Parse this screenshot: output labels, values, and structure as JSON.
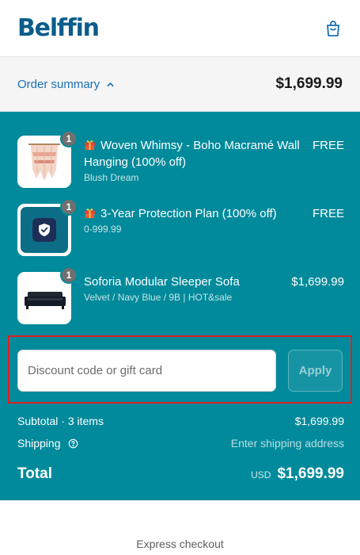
{
  "brand": {
    "logo_text": "Belffin"
  },
  "summary": {
    "toggle_label": "Order summary",
    "total": "$1,699.99"
  },
  "items": [
    {
      "title": "Woven Whimsy - Boho Macramé Wall Hanging (100% off)",
      "variant": "Blush Dream",
      "price": "FREE",
      "quantity": "1",
      "gift": true
    },
    {
      "title": "3-Year Protection Plan (100% off)",
      "variant": "0-999.99",
      "price": "FREE",
      "quantity": "1",
      "gift": true
    },
    {
      "title": "Soforia Modular Sleeper Sofa",
      "variant": "Velvet / Navy Blue / 9B | HOT&sale",
      "price": "$1,699.99",
      "quantity": "1",
      "gift": false
    }
  ],
  "discount": {
    "placeholder": "Discount code or gift card",
    "value": "",
    "apply_label": "Apply"
  },
  "totals": {
    "subtotal_label": "Subtotal · 3 items",
    "subtotal_value": "$1,699.99",
    "shipping_label": "Shipping",
    "shipping_value": "Enter shipping address",
    "total_label": "Total",
    "currency": "USD",
    "total_value": "$1,699.99"
  },
  "express": {
    "label": "Express checkout"
  },
  "colors": {
    "brand": "#0b5d8a",
    "panel": "#008a9b",
    "link": "#1a6fb5",
    "highlight": "#e02020"
  }
}
